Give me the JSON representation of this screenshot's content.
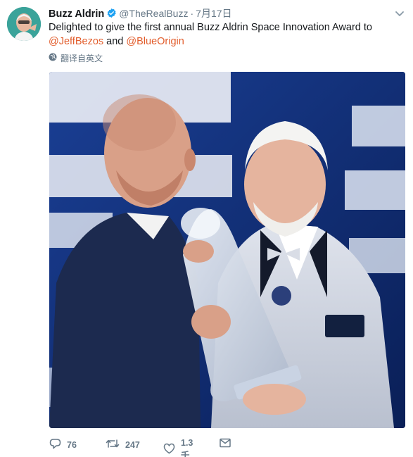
{
  "tweet": {
    "author_name": "Buzz Aldrin",
    "handle": "@TheRealBuzz",
    "separator": "·",
    "timestamp": "7月17日",
    "text_before": "Delighted to give the first annual Buzz Aldrin Space Innovation Award to",
    "mention_1": "@JeffBezos",
    "text_and": "and",
    "mention_2": "@BlueOrigin",
    "translate_label": "翻译自英文",
    "reply_count": "76",
    "retweet_count": "247",
    "like_count": "1.3千"
  },
  "icons": {
    "verified": "verified-badge-icon",
    "caret": "chevron-down-icon",
    "translate": "globe-icon",
    "reply": "reply-icon",
    "retweet": "retweet-icon",
    "like": "heart-icon",
    "dm": "envelope-icon"
  },
  "colors": {
    "mention": "#e25d2c",
    "meta": "#657786",
    "verified": "#1da1f2",
    "photo_background": "#0e2a6b"
  }
}
